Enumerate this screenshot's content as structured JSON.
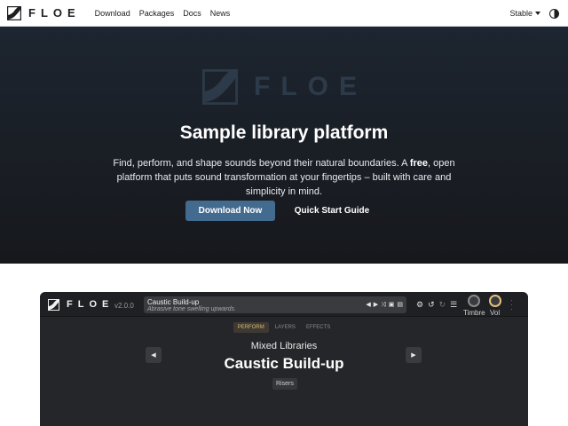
{
  "navbar": {
    "brand": "FLOE",
    "links": [
      "Download",
      "Packages",
      "Docs",
      "News"
    ],
    "version": "Stable",
    "icons": [
      "floe-logo-icon",
      "caret-down-icon",
      "theme-toggle-icon"
    ]
  },
  "hero": {
    "watermark": "FLOE",
    "title": "Sample library platform",
    "desc_1": "Find, perform, and shape sounds beyond their natural boundaries. A ",
    "desc_bold": "free",
    "desc_2": ", open platform that puts sound transformation at your fingertips – built with care and simplicity in mind.",
    "primary_button": "Download Now",
    "secondary_button": "Quick Start Guide"
  },
  "app": {
    "brand": "FLOE",
    "version": "v2.0.0",
    "preset_name": "Caustic Build-up",
    "preset_desc": "Abrasive tone swelling upwards.",
    "knobs": [
      "Timbre",
      "Vol"
    ],
    "tabs": [
      "PERFORM",
      "LAYERS",
      "EFFECTS"
    ],
    "active_tab": "PERFORM",
    "library": "Mixed Libraries",
    "big_preset": "Caustic Build-up",
    "tag": "Risers",
    "colors": {
      "accent": "#d8b870",
      "primary_button": "#436b8f"
    }
  }
}
